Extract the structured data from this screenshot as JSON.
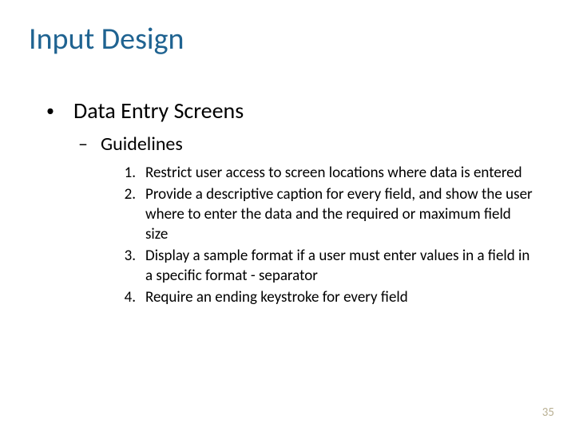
{
  "title": "Input Design",
  "level1": {
    "bullet": "•",
    "text": "Data Entry Screens"
  },
  "level2": {
    "dash": "–",
    "text": "Guidelines"
  },
  "items": [
    {
      "n": "1.",
      "t": "Restrict user access to screen locations where data is entered"
    },
    {
      "n": "2.",
      "t": "Provide a descriptive caption for every field, and show the user where to enter the data and the required or maximum field size"
    },
    {
      "n": "3.",
      "t": "Display a sample format if a user must enter values in a field in a specific format - separator"
    },
    {
      "n": "4.",
      "t": "Require an ending keystroke for every field"
    }
  ],
  "page": "35"
}
